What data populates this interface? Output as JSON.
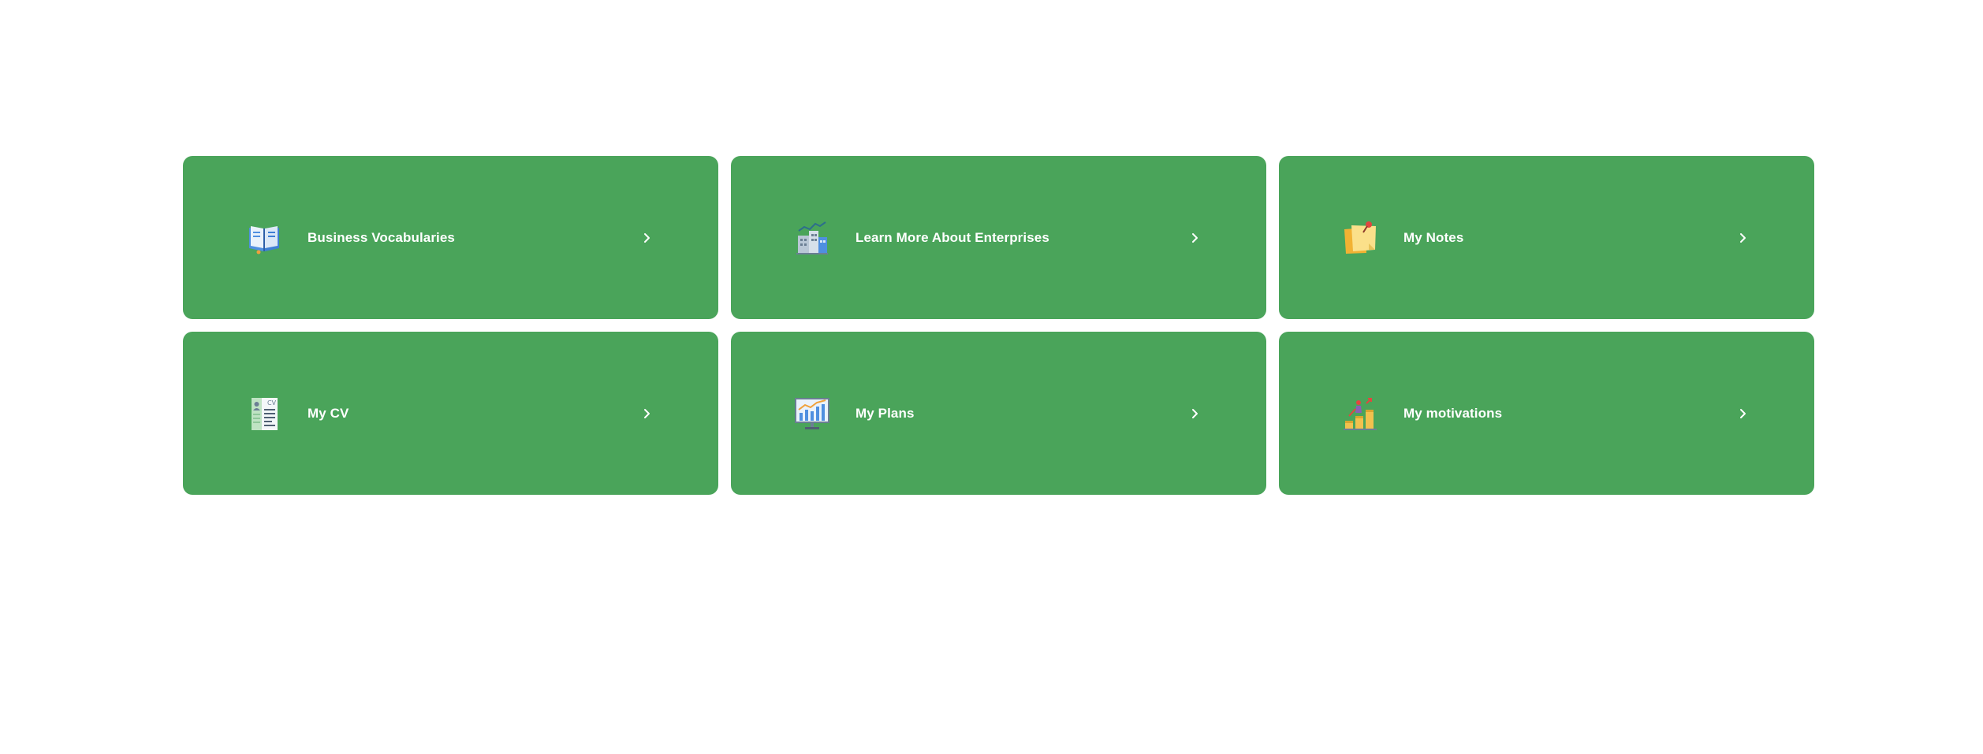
{
  "cards": [
    {
      "label": "Business Vocabularies",
      "icon": "open-book-icon"
    },
    {
      "label": "Learn More About Enterprises",
      "icon": "office-building-chart-icon"
    },
    {
      "label": "My Notes",
      "icon": "sticky-notes-icon"
    },
    {
      "label": "My CV",
      "icon": "cv-document-icon"
    },
    {
      "label": "My Plans",
      "icon": "presentation-chart-icon"
    },
    {
      "label": "My motivations",
      "icon": "growth-podium-icon"
    }
  ],
  "colors": {
    "card_background": "#4aa45a",
    "card_text": "#ffffff",
    "page_background": "#ffffff"
  }
}
